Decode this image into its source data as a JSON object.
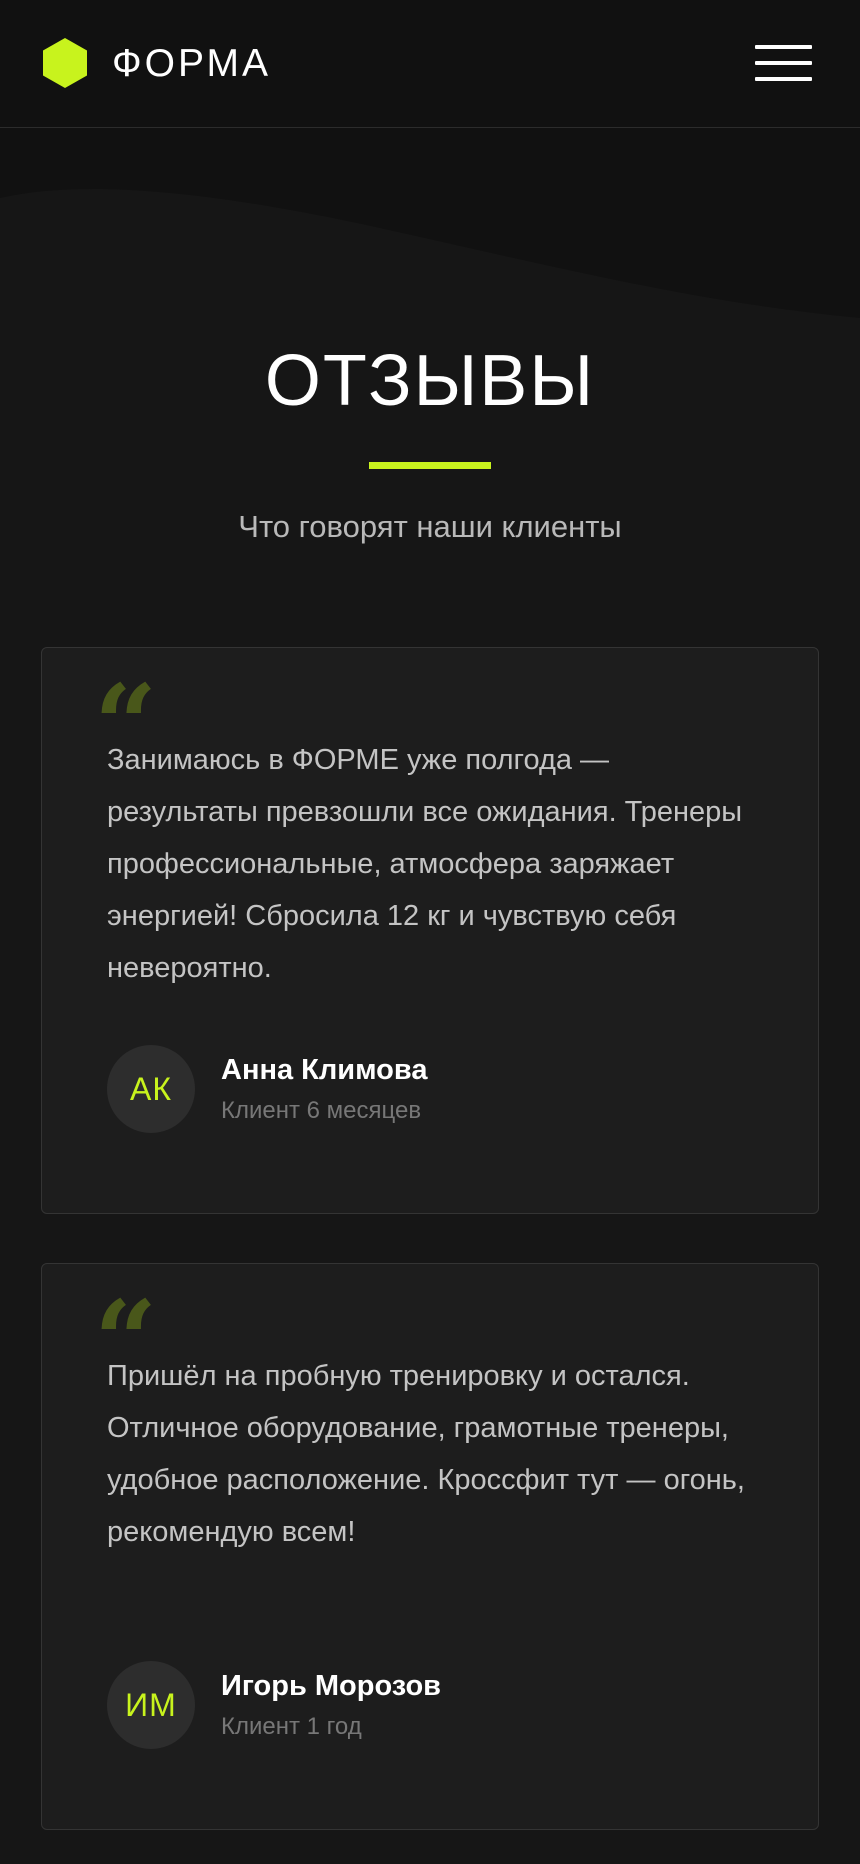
{
  "header": {
    "logo_text": "ФОРМА",
    "logo_icon": "hexagon-logo-icon",
    "menu_icon": "hamburger-menu-icon",
    "accent_color": "#c8f31d"
  },
  "section": {
    "title": "ОТЗЫВЫ",
    "subtitle": "Что говорят наши клиенты"
  },
  "reviews": [
    {
      "text": "Занимаюсь в ФОРМЕ уже полгода — результаты превзошли все ожидания. Тренеры профессиональные, атмосфера заряжает энергией! Сбросила 12 кг и чувствую себя невероятно.",
      "initials": "АК",
      "name": "Анна Климова",
      "meta": "Клиент 6 месяцев"
    },
    {
      "text": "Пришёл на пробную тренировку и остался. Отличное оборудование, грамотные тренеры, удобное расположение. Кроссфит тут — огонь, рекомендую всем!",
      "initials": "ИМ",
      "name": "Игорь Морозов",
      "meta": "Клиент 1 год"
    }
  ]
}
